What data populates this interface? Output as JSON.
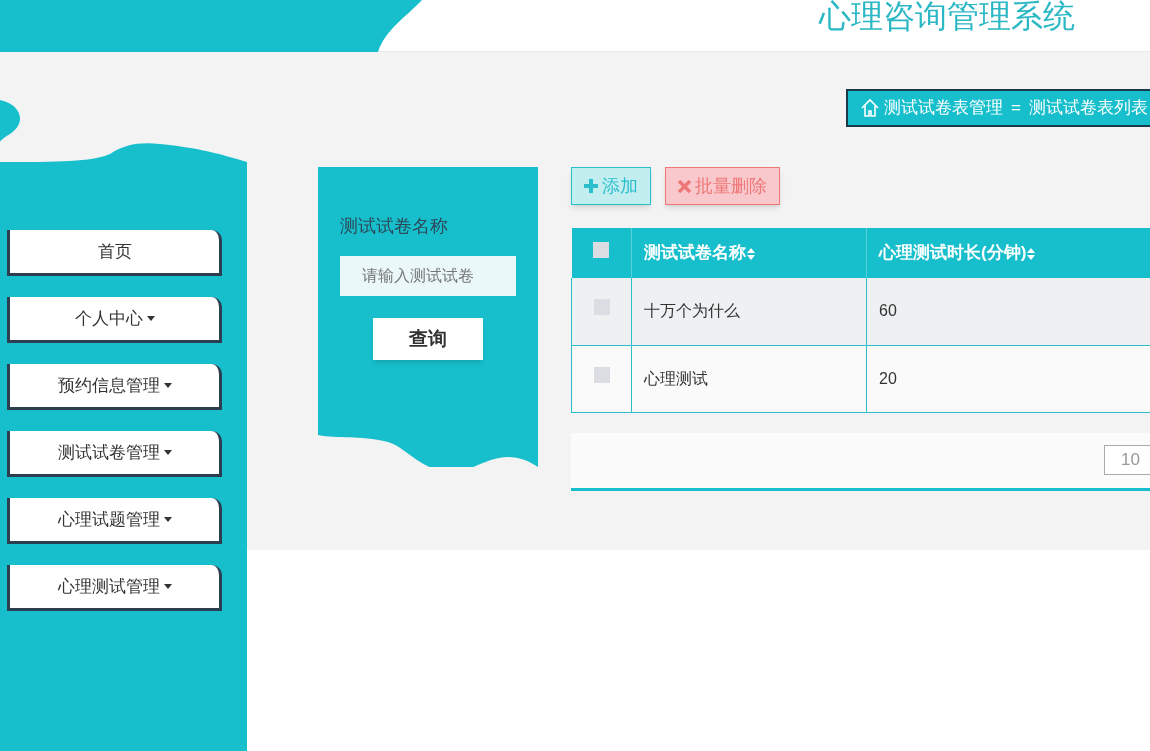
{
  "header": {
    "title": "心理咨询管理系统"
  },
  "breadcrumb": {
    "section": "测试试卷表管理",
    "separator": "=",
    "page": "测试试卷表列表"
  },
  "sidebar": {
    "items": [
      {
        "label": "首页",
        "has_menu": false
      },
      {
        "label": "个人中心",
        "has_menu": true
      },
      {
        "label": "预约信息管理",
        "has_menu": true
      },
      {
        "label": "测试试卷管理",
        "has_menu": true
      },
      {
        "label": "心理试题管理",
        "has_menu": true
      },
      {
        "label": "心理测试管理",
        "has_menu": true
      }
    ]
  },
  "search": {
    "label": "测试试卷名称",
    "placeholder": "请输入测试试卷",
    "button": "查询"
  },
  "toolbar": {
    "add": "添加",
    "batch_delete": "批量删除"
  },
  "table": {
    "select_all_checked": false,
    "columns": [
      "测试试卷名称",
      "心理测试时长(分钟)"
    ],
    "rows": [
      {
        "checked": false,
        "cells": [
          "十万个为什么",
          "60"
        ]
      },
      {
        "checked": false,
        "cells": [
          "心理测试",
          "20"
        ]
      }
    ]
  },
  "pagination": {
    "page_size": "10"
  }
}
